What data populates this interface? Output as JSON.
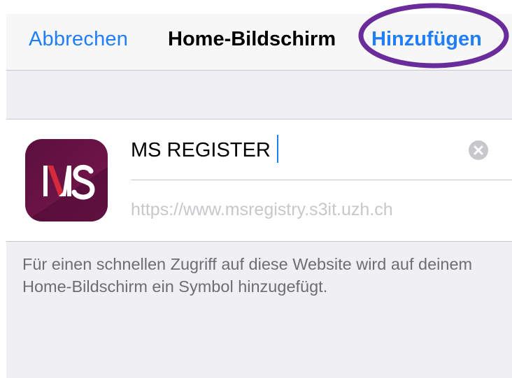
{
  "navbar": {
    "cancel_label": "Abbrechen",
    "title": "Home-Bildschirm",
    "add_label": "Hinzufügen"
  },
  "app": {
    "icon_text": "MS",
    "name_value": "MS REGISTER",
    "url": "https://www.msregistry.s3it.uzh.ch"
  },
  "description": "Für einen schnellen Zugriff auf diese Website wird auf deinem Home-Bildschirm ein Symbol hinzugefügt.",
  "colors": {
    "accent": "#1f7ef8",
    "highlight": "#6a2c9a",
    "icon_bg": "#6b1145",
    "icon_red": "#d42a3c"
  },
  "icons": {
    "clear": "clear-x-icon",
    "app": "app-icon"
  }
}
